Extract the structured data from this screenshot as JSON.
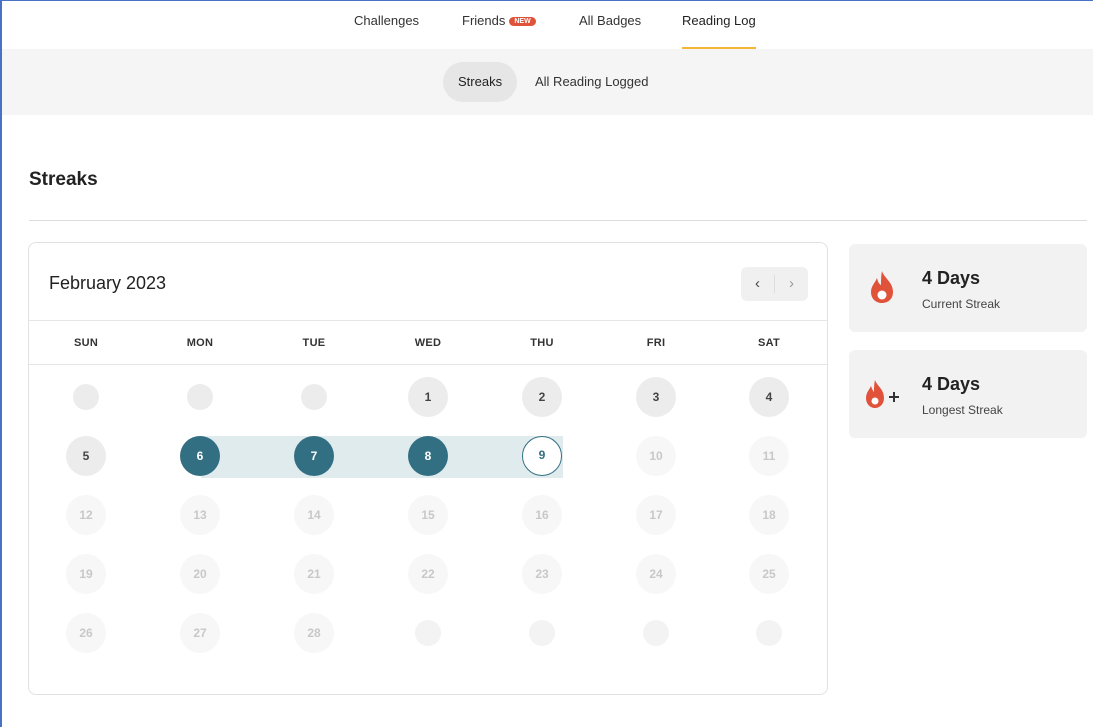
{
  "topnav": {
    "tabs": [
      {
        "label": "Challenges"
      },
      {
        "label": "Friends",
        "badge": "NEW"
      },
      {
        "label": "All Badges"
      },
      {
        "label": "Reading Log",
        "active": true
      }
    ]
  },
  "subnav": {
    "streaks_label": "Streaks",
    "all_reading_label": "All Reading Logged"
  },
  "page": {
    "title": "Streaks"
  },
  "calendar": {
    "month_label": "February 2023",
    "prev_label": "‹",
    "next_label": "›",
    "weekdays": [
      "SUN",
      "MON",
      "TUE",
      "WED",
      "THU",
      "FRI",
      "SAT"
    ],
    "weeks": [
      [
        "",
        "",
        "",
        "1",
        "2",
        "3",
        "4"
      ],
      [
        "5",
        "6",
        "7",
        "8",
        "9",
        "10",
        "11"
      ],
      [
        "12",
        "13",
        "14",
        "15",
        "16",
        "17",
        "18"
      ],
      [
        "19",
        "20",
        "21",
        "22",
        "23",
        "24",
        "25"
      ],
      [
        "26",
        "27",
        "28",
        "",
        "",
        "",
        ""
      ]
    ],
    "streak_days": [
      6,
      7,
      8
    ],
    "today": 9
  },
  "stats": {
    "current": {
      "value": "4 Days",
      "label": "Current Streak"
    },
    "longest": {
      "value": "4 Days",
      "label": "Longest Streak"
    }
  },
  "colors": {
    "accent": "#336f82",
    "fire": "#e0533a",
    "tab_underline": "#f3b735"
  }
}
